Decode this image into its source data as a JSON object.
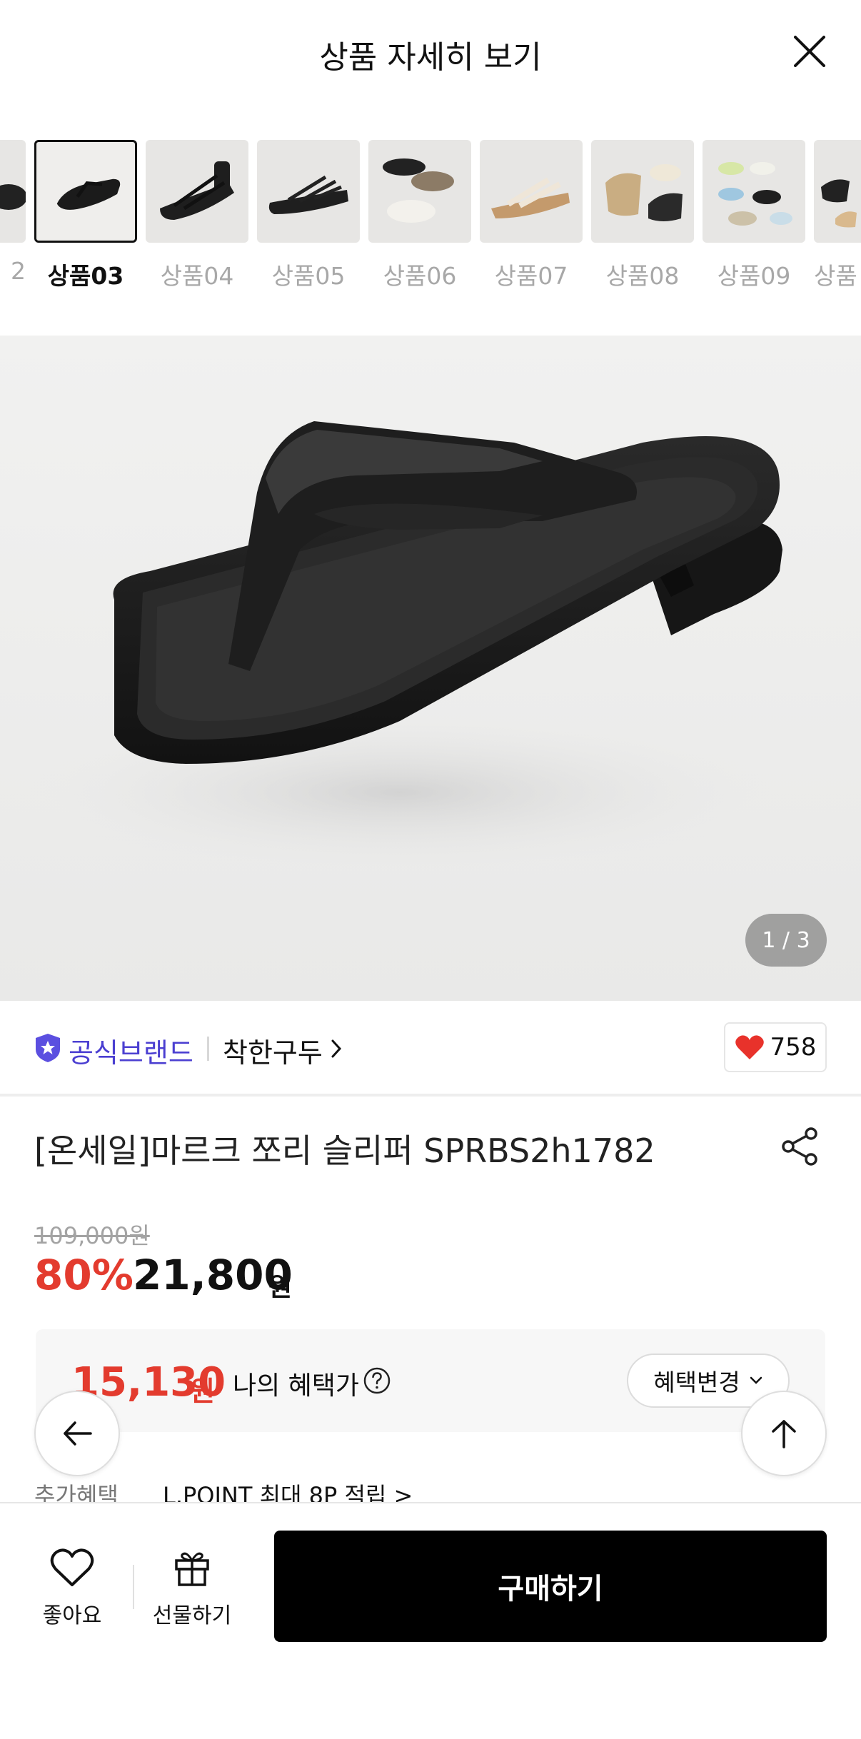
{
  "header": {
    "title": "상품 자세히 보기",
    "close_icon": "close-icon"
  },
  "thumbnails": [
    {
      "label": "2",
      "selected": false
    },
    {
      "label": "상품03",
      "selected": true
    },
    {
      "label": "상품04",
      "selected": false
    },
    {
      "label": "상품05",
      "selected": false
    },
    {
      "label": "상품06",
      "selected": false
    },
    {
      "label": "상품07",
      "selected": false
    },
    {
      "label": "상품08",
      "selected": false
    },
    {
      "label": "상품09",
      "selected": false
    },
    {
      "label": "상품",
      "selected": false
    }
  ],
  "hero": {
    "counter": "1 / 3"
  },
  "brand": {
    "official_label": "공식브랜드",
    "name": "착한구두",
    "like_count": "758",
    "heart_color": "#e8322b",
    "badge_color": "#5b4fe0"
  },
  "product": {
    "name": "[온세일]마르크 쪼리 슬리퍼 SPRBS2h1782",
    "original_price": "109,000원",
    "discount": "80%",
    "sale_price": "21,800",
    "sale_won": "원"
  },
  "benefit": {
    "price": "15,130",
    "won": "원",
    "label": "나의 혜택가",
    "change_button": "혜택변경"
  },
  "extra": {
    "label": "추가혜택",
    "text": "L.POINT 최대 8P 적립 >"
  },
  "bottom": {
    "like_label": "좋아요",
    "gift_label": "선물하기",
    "buy_label": "구매하기"
  },
  "colors": {
    "accent_red": "#e33b2e",
    "brand_purple": "#4b3fd1"
  }
}
